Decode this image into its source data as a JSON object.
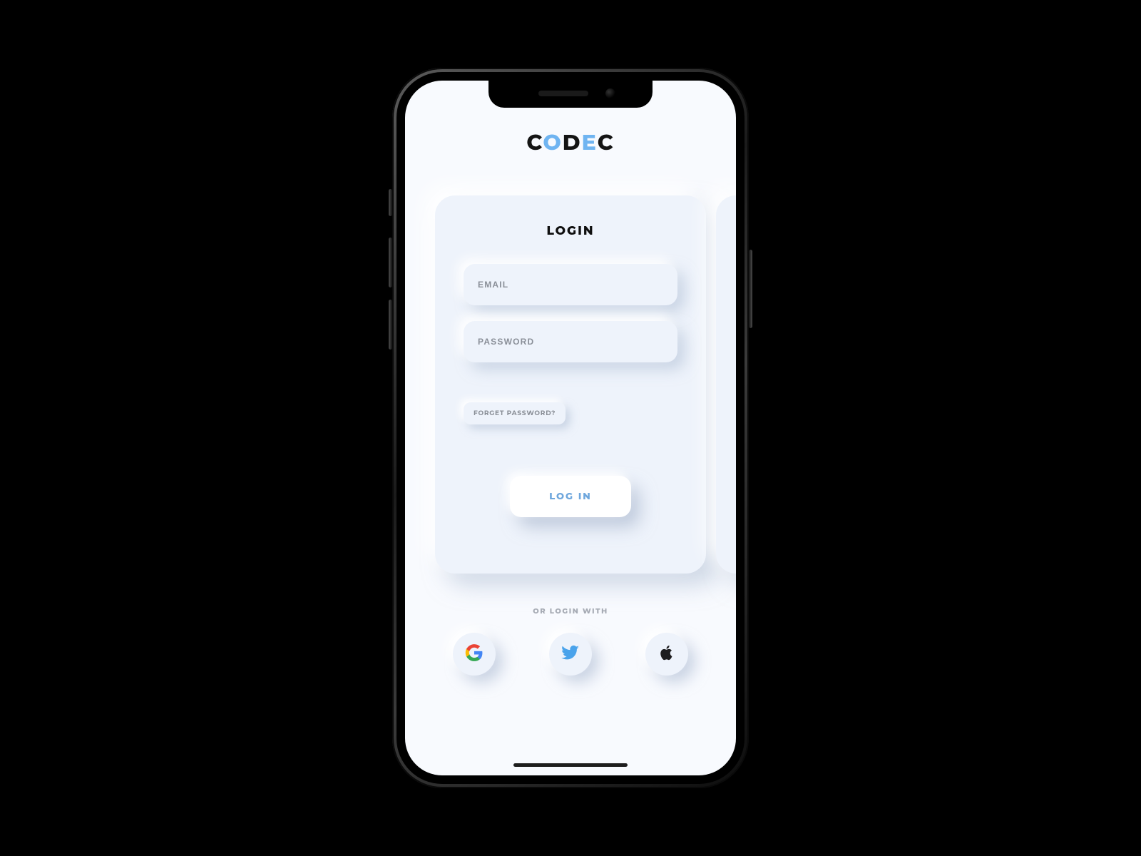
{
  "brand": {
    "c1": "C",
    "c2": "O",
    "c3": "D",
    "c4": "E",
    "c5": "C"
  },
  "card": {
    "title": "LOGIN",
    "email_placeholder": "EMAIL",
    "password_placeholder": "PASSWORD",
    "forget_label": "FORGET PASSWORD?",
    "submit_label": "LOG IN"
  },
  "social": {
    "label": "OR LOGIN WITH",
    "google": "google",
    "twitter": "twitter",
    "apple": "apple"
  },
  "colors": {
    "accent": "#6fb4f1",
    "twitter": "#4aa3eb",
    "text_muted": "#8a8f98"
  }
}
